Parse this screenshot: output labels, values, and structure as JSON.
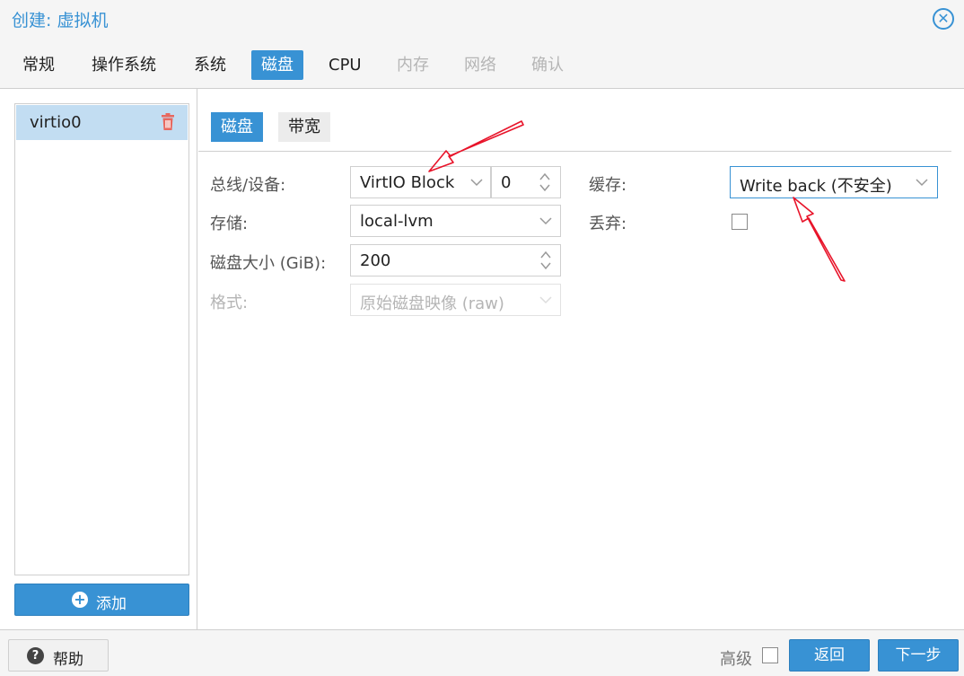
{
  "window": {
    "title": "创建: 虚拟机",
    "close_icon": "close-circle-icon"
  },
  "tabs": [
    "常规",
    "操作系统",
    "系统",
    "磁盘",
    "CPU",
    "内存",
    "网络",
    "确认"
  ],
  "active_tab": "磁盘",
  "disk_list": {
    "items": [
      "virtio0"
    ],
    "selected": "virtio0",
    "add_label": "添加"
  },
  "subtabs": {
    "disk": "磁盘",
    "bandwidth": "带宽"
  },
  "form": {
    "bus_label": "总线/设备:",
    "bus_value": "VirtIO Block",
    "device_index": "0",
    "storage_label": "存储:",
    "storage_value": "local-lvm",
    "size_label": "磁盘大小 (GiB):",
    "size_value": "200",
    "format_label": "格式:",
    "format_value": "原始磁盘映像 (raw)",
    "cache_label": "缓存:",
    "cache_value": "Write back (不安全)",
    "discard_label": "丢弃:"
  },
  "footer": {
    "help": "帮助",
    "advanced": "高级",
    "back": "返回",
    "next": "下一步"
  },
  "colors": {
    "accent": "#3892d4",
    "selected_row": "#c2ddf2",
    "trash": "#e8685f",
    "annotation_arrow": "#e8142a"
  }
}
